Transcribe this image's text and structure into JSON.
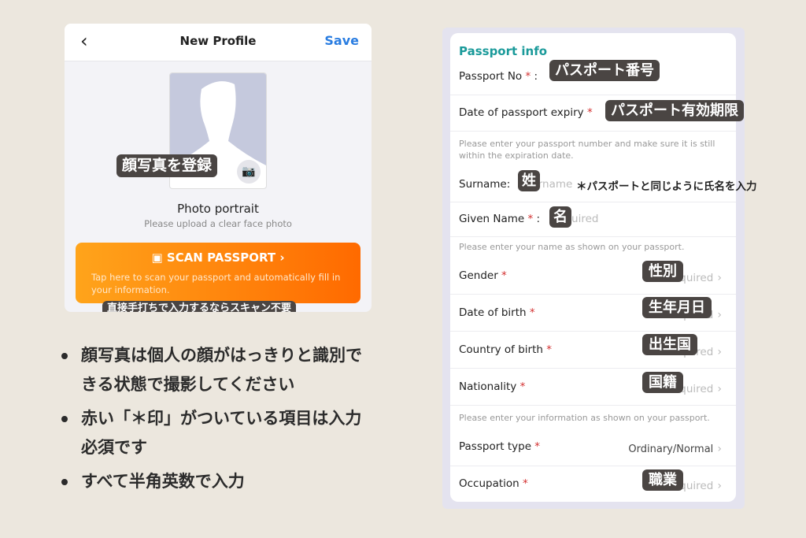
{
  "left_card": {
    "back_icon": "chevron-left-icon",
    "title": "New Profile",
    "save_label": "Save",
    "photo_label": "Photo portrait",
    "photo_hint": "Please upload a clear face photo",
    "camera_icon": "camera-icon",
    "scan_title": "SCAN PASSPORT",
    "scan_desc": "Tap here to scan your passport and automatically fill in your information.",
    "photo_annotation": "顔写真を登録",
    "scan_annotation": "直接手打ちで入力するならスキャン不要",
    "scan_color_start": "#ffa41b",
    "scan_color_end": "#ff6a00"
  },
  "bullets": [
    "顔写真は個人の顔がはっきりと識別できる状態で撮影してください",
    "赤い「＊印」がついている項目は入力必須です",
    "すべて半角英数で入力"
  ],
  "form": {
    "section_title": "Passport info",
    "accent_color": "#1a9a9a",
    "required_mark": "*",
    "passport_no": {
      "label": "Passport No",
      "annotation": "パスポート番号"
    },
    "expiry": {
      "label": "Date of passport expiry",
      "annotation": "パスポート有効期限"
    },
    "hint1": "Please enter your passport number and make sure it is still within the expiration date.",
    "surname": {
      "label": "Surname:",
      "placeholder": "Surname",
      "annotation": "姓"
    },
    "name_note": "＊パスポートと同じように氏名を入力",
    "given": {
      "label": "Given Name",
      "placeholder": "Required",
      "annotation": "名"
    },
    "hint2": "Please enter your name as shown on your passport.",
    "gender": {
      "label": "Gender",
      "placeholder": "Required",
      "annotation": "性別"
    },
    "dob": {
      "label": "Date of birth",
      "placeholder": "Required",
      "annotation": "生年月日"
    },
    "country": {
      "label": "Country of birth",
      "placeholder": "Required",
      "annotation": "出生国"
    },
    "nationality": {
      "label": "Nationality",
      "placeholder": "Required",
      "annotation": "国籍"
    },
    "hint3": "Please enter your information as shown on your passport.",
    "passport_type": {
      "label": "Passport type",
      "value": "Ordinary/Normal"
    },
    "occupation": {
      "label": "Occupation",
      "placeholder": "Required",
      "annotation": "職業"
    }
  }
}
